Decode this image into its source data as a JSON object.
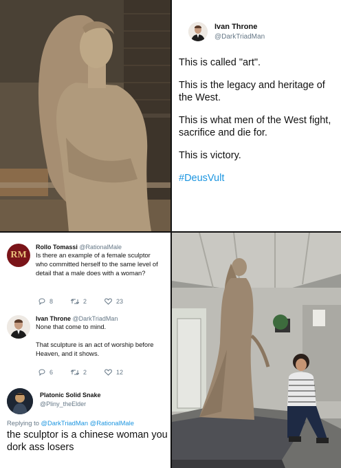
{
  "tweet_main": {
    "name": "Ivan Throne",
    "handle": "@DarkTriadMan",
    "lines": [
      "This is called \"art\".",
      "This is the legacy and heritage of the West.",
      "This is what men of the West fight, sacrifice and die for.",
      "This is victory."
    ],
    "hashtag": "#DeusVult"
  },
  "thread": {
    "rollo": {
      "name": "Rollo Tomassi",
      "handle": "@RationalMale",
      "avatar_text": "RM",
      "text": "Is there an example of a female sculptor who committed herself to the same level of detail that a male does with a woman?",
      "replies": "8",
      "retweets": "2",
      "likes": "23"
    },
    "ivan_reply": {
      "name": "Ivan Throne",
      "handle": "@DarkTriadMan",
      "line1": "None that come to mind.",
      "line2": "That sculpture is an act of worship before Heaven, and it shows.",
      "replies": "6",
      "retweets": "2",
      "likes": "12"
    },
    "snake": {
      "name": "Platonic Solid Snake",
      "handle": "@Pliny_theElder",
      "replying_label": "Replying to",
      "replying_handles": "@DarkTriadMan @RationalMale",
      "text": "the sculptor is a chinese woman you dork ass losers"
    }
  },
  "colors": {
    "link": "#1b95e0",
    "muted": "#657786",
    "rm_logo_bg": "#7a1419"
  }
}
